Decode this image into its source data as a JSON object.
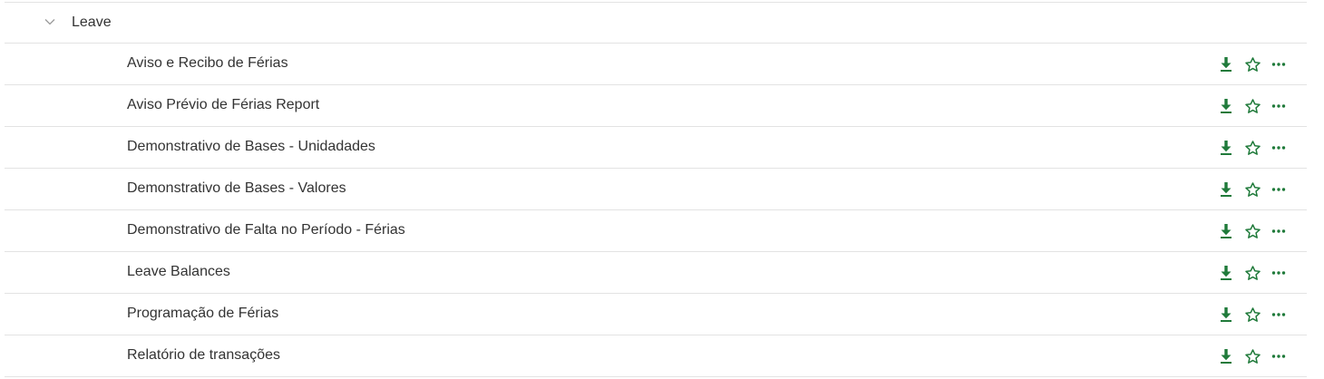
{
  "group": {
    "label": "Leave",
    "expanded": true,
    "chevron_icon": "chevron-down-icon"
  },
  "rows": [
    {
      "label": "Aviso e Recibo de Férias"
    },
    {
      "label": "Aviso Prévio de Férias Report"
    },
    {
      "label": "Demonstrativo de Bases - Unidadades"
    },
    {
      "label": "Demonstrativo de Bases - Valores"
    },
    {
      "label": "Demonstrativo de Falta no Período - Férias"
    },
    {
      "label": "Leave Balances"
    },
    {
      "label": "Programação de Férias"
    },
    {
      "label": "Relatório de transações"
    }
  ],
  "row_actions": {
    "icons": [
      "download-icon",
      "star-icon",
      "more-options-icon"
    ]
  },
  "colors": {
    "accent_green": "#1f7a3a",
    "text": "#333333",
    "divider": "#e3e3e3",
    "chevron": "#9a9a9a"
  }
}
